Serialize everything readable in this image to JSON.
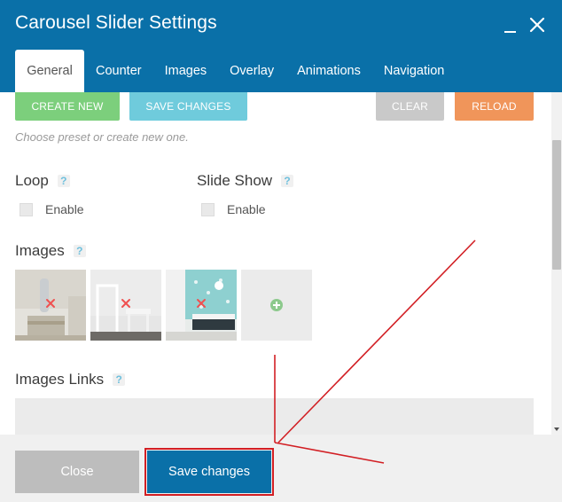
{
  "window": {
    "title": "Carousel Slider Settings"
  },
  "tabs": [
    {
      "label": "General",
      "active": true
    },
    {
      "label": "Counter"
    },
    {
      "label": "Images"
    },
    {
      "label": "Overlay"
    },
    {
      "label": "Animations"
    },
    {
      "label": "Navigation"
    }
  ],
  "presets": {
    "create_label": "Create New",
    "save_label": "Save Changes",
    "clear_label": "Clear",
    "reload_label": "Reload",
    "hint": "Choose preset or create new one."
  },
  "loop": {
    "label": "Loop",
    "help": "?",
    "option": "Enable"
  },
  "slideshow": {
    "label": "Slide Show",
    "help": "?",
    "option": "Enable"
  },
  "images": {
    "label": "Images",
    "help": "?"
  },
  "images_links": {
    "label": "Images Links",
    "help": "?"
  },
  "footer": {
    "close_label": "Close",
    "save_label": "Save changes"
  },
  "colors": {
    "header": "#0a70a8",
    "create": "#7ccf7c",
    "save_top": "#6fcbdc",
    "clear": "#c9c9c9",
    "reload": "#f0955a",
    "annotation": "#d21f24"
  }
}
